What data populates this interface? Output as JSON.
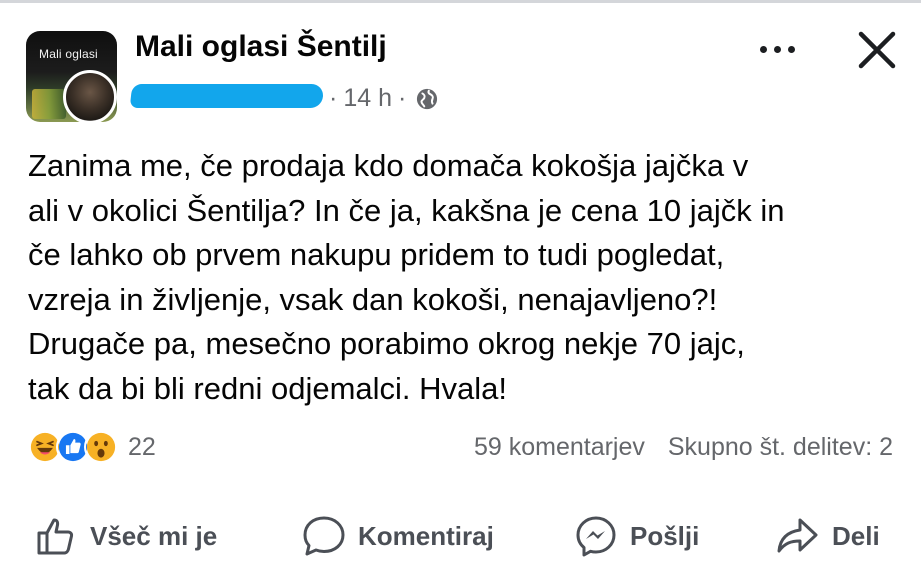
{
  "post": {
    "group_name": "Mali oglasi Šentilj",
    "group_logo_text": "Mali oglasi",
    "time": "14 h",
    "dot": "·",
    "text": "Zanima me, če prodaja kdo domača kokošja jajčka v\nali v okolici Šentilja? In če ja, kakšna je cena 10 jajčk in\nče lahko ob prvem nakupu pridem to tudi pogledat,\nvzreja in življenje, vsak dan kokoši, nenajavljeno?!\nDrugače pa, mesečno porabimo okrog nekje 70 jajc,\ntak da bi bli redni odjemalci. Hvala!"
  },
  "engagement": {
    "reaction_count": "22",
    "comments": "59 komentarjev",
    "shares": "Skupno št. delitev: 2",
    "reactions": [
      "haha",
      "like",
      "wow"
    ]
  },
  "actions": {
    "like": "Všeč mi je",
    "comment": "Komentiraj",
    "send": "Pošlji",
    "share": "Deli"
  },
  "colors": {
    "text": "#050505",
    "secondary": "#65676b",
    "like_blue": "#1877f2",
    "reaction_yellow": "#f7b125",
    "redaction": "#12a6ec"
  }
}
